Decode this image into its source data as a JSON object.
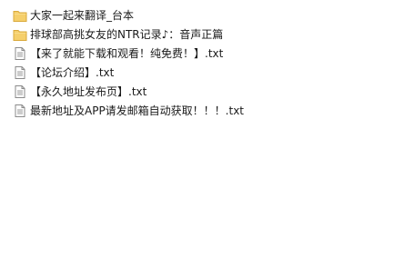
{
  "files": [
    {
      "name": "大家一起来翻译_台本",
      "icon": "folder-icon",
      "type": "folder"
    },
    {
      "name": "排球部高挑女友的NTR记录♪：音声正篇",
      "icon": "folder-icon",
      "type": "folder"
    },
    {
      "name": "【来了就能下载和观看！纯免费！】.txt",
      "icon": "text-file-icon",
      "type": "file"
    },
    {
      "name": "【论坛介绍】.txt",
      "icon": "text-file-icon",
      "type": "file"
    },
    {
      "name": "【永久地址发布页】.txt",
      "icon": "text-file-icon",
      "type": "file"
    },
    {
      "name": "最新地址及APP请发邮箱自动获取！！！.txt",
      "icon": "text-file-icon",
      "type": "file"
    }
  ],
  "colors": {
    "folder_fill": "#f5cf6b",
    "folder_edge": "#d9a93a",
    "file_fill": "#ffffff",
    "file_edge": "#8a8a8a"
  }
}
